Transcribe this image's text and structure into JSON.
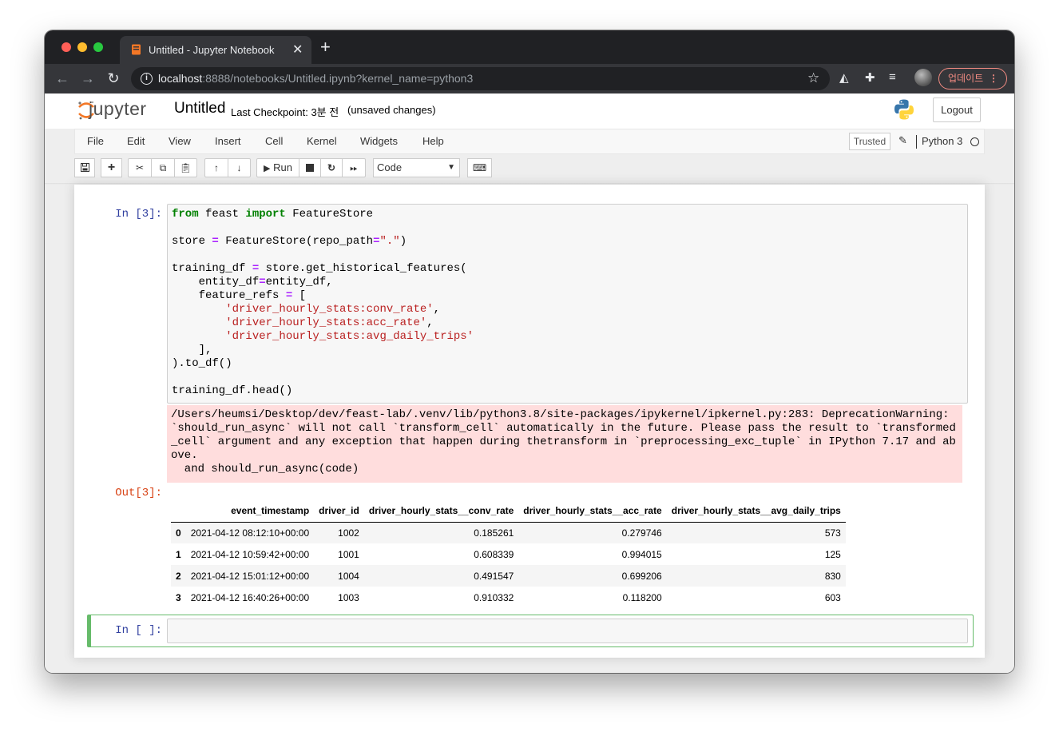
{
  "browser": {
    "tab_title": "Untitled - Jupyter Notebook",
    "url_host": "localhost",
    "url_rest": ":8888/notebooks/Untitled.ipynb?kernel_name=python3",
    "update_label": "업데이트"
  },
  "header": {
    "logo_text": "jupyter",
    "notebook_name": "Untitled",
    "checkpoint": "Last Checkpoint: 3분 전",
    "unsaved": "(unsaved changes)",
    "logout_label": "Logout"
  },
  "menubar": {
    "items": [
      "File",
      "Edit",
      "View",
      "Insert",
      "Cell",
      "Kernel",
      "Widgets",
      "Help"
    ],
    "trusted_label": "Trusted",
    "kernel_name": "Python 3"
  },
  "toolbar": {
    "run_label": "Run",
    "cell_type": "Code"
  },
  "cells": {
    "in3_prompt": "In [3]:",
    "out3_prompt": "Out[3]:",
    "in_empty_prompt": "In [ ]:",
    "stderr": "/Users/heumsi/Desktop/dev/feast-lab/.venv/lib/python3.8/site-packages/ipykernel/ipkernel.py:283: DeprecationWarning:\n`should_run_async` will not call `transform_cell` automatically in the future. Please pass the result to `transformed\n_cell` argument and any exception that happen during thetransform in `preprocessing_exc_tuple` in IPython 7.17 and ab\nove.\n  and should_run_async(code)"
  },
  "table": {
    "columns": [
      "",
      "event_timestamp",
      "driver_id",
      "driver_hourly_stats__conv_rate",
      "driver_hourly_stats__acc_rate",
      "driver_hourly_stats__avg_daily_trips"
    ],
    "rows": [
      [
        "0",
        "2021-04-12 08:12:10+00:00",
        "1002",
        "0.185261",
        "0.279746",
        "573"
      ],
      [
        "1",
        "2021-04-12 10:59:42+00:00",
        "1001",
        "0.608339",
        "0.994015",
        "125"
      ],
      [
        "2",
        "2021-04-12 15:01:12+00:00",
        "1004",
        "0.491547",
        "0.699206",
        "830"
      ],
      [
        "3",
        "2021-04-12 16:40:26+00:00",
        "1003",
        "0.910332",
        "0.118200",
        "603"
      ]
    ]
  }
}
